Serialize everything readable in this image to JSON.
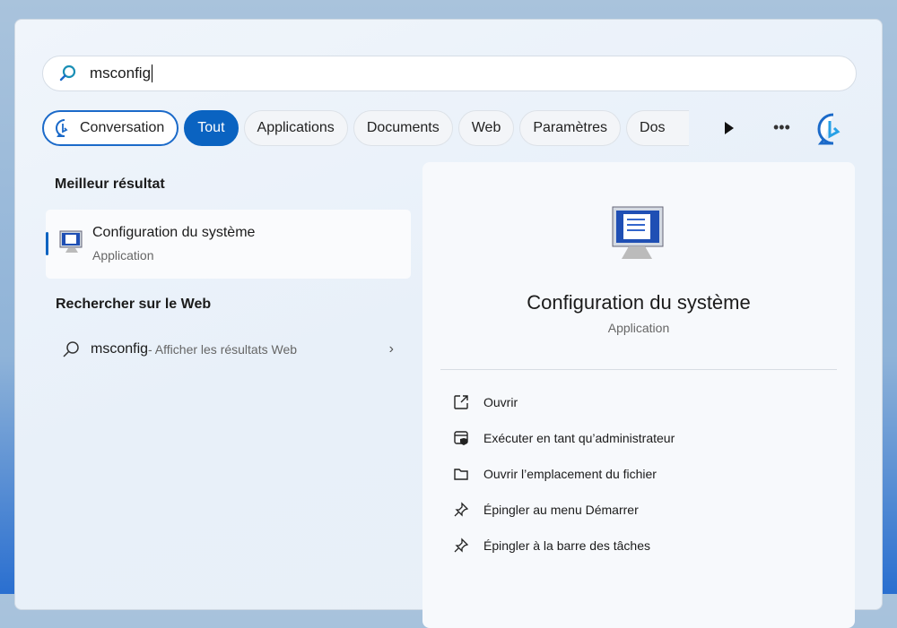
{
  "search": {
    "query": "msconfig"
  },
  "filters": [
    {
      "label": "Conversation"
    },
    {
      "label": "Tout",
      "selected": true
    },
    {
      "label": "Applications"
    },
    {
      "label": "Documents"
    },
    {
      "label": "Web"
    },
    {
      "label": "Paramètres"
    },
    {
      "label": "Dos"
    }
  ],
  "best": {
    "heading": "Meilleur résultat",
    "title": "Configuration du système",
    "subtitle": "Application"
  },
  "web": {
    "heading": "Rechercher sur le Web",
    "query": "msconfig",
    "desc": " - Afficher les résultats Web"
  },
  "detail": {
    "title": "Configuration du système",
    "subtitle": "Application",
    "actions": [
      {
        "label": "Ouvrir",
        "icon": "open-icon"
      },
      {
        "label": "Exécuter en tant qu’administrateur",
        "icon": "admin-shield-icon"
      },
      {
        "label": "Ouvrir l’emplacement du fichier",
        "icon": "folder-icon"
      },
      {
        "label": "Épingler au menu Démarrer",
        "icon": "pin-icon"
      },
      {
        "label": "Épingler à la barre des tâches",
        "icon": "pin-icon"
      }
    ]
  },
  "colors": {
    "accent": "#0a63c1"
  }
}
